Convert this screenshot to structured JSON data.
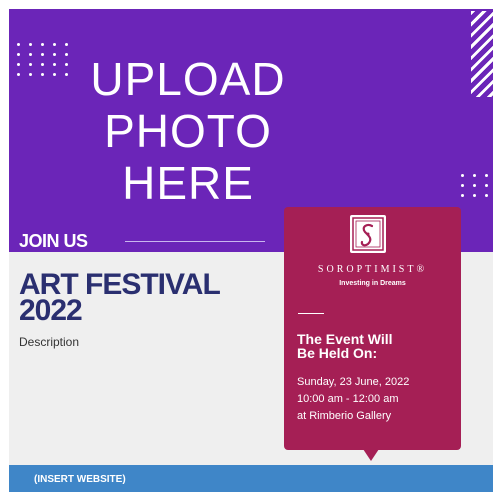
{
  "photo": {
    "text": "UPLOAD\nPHOTO\nHERE"
  },
  "join": {
    "label": "JOIN US"
  },
  "event": {
    "title": "ART FESTIVAL\n2022",
    "description": "Description"
  },
  "brand": {
    "name": "SOROPTIMIST®",
    "tagline": "Investing in Dreams"
  },
  "details": {
    "heading": "The Event Will\nBe Held On:",
    "date": "Sunday, 23 June, 2022",
    "time": "10:00 am - 12:00 am",
    "location": "at Rimberio Gallery"
  },
  "footer": {
    "website": "(INSERT WEBSITE)"
  },
  "colors": {
    "purple_header": "#6b25b8",
    "event_panel": "#a51f55",
    "title_navy": "#2a2f70",
    "footer_blue": "#3f86c8",
    "background_light": "#efefef"
  },
  "icons": [
    "soroptimist-logo-icon",
    "dot-grid-icon",
    "stripe-pattern-icon"
  ]
}
